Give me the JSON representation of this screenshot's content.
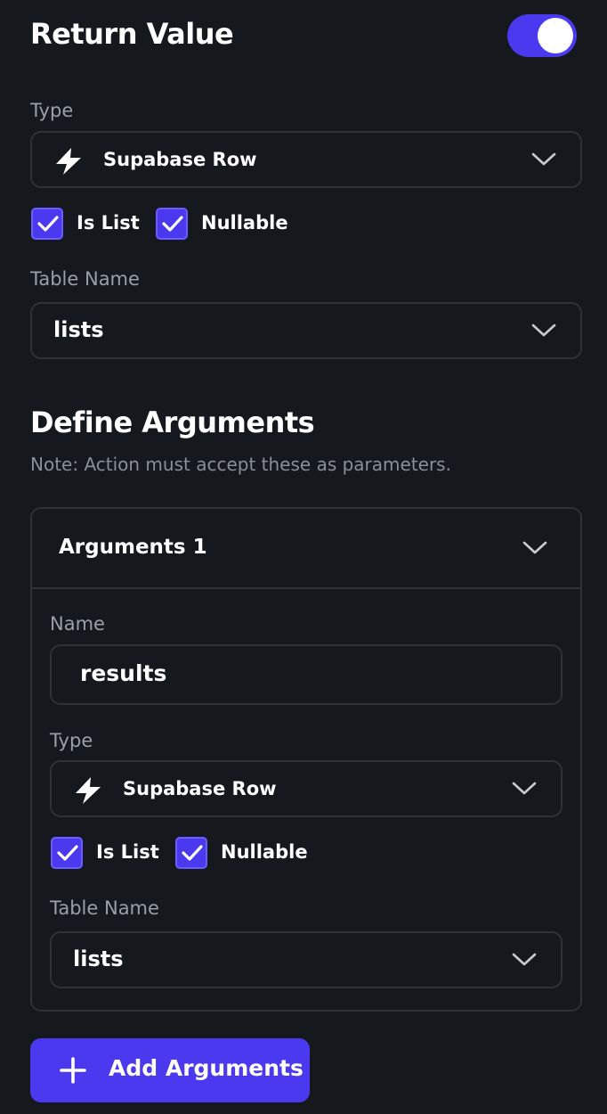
{
  "return_value": {
    "title": "Return Value",
    "toggle_on": true,
    "type_label": "Type",
    "type_value": "Supabase Row",
    "is_list_label": "Is List",
    "is_list_checked": true,
    "nullable_label": "Nullable",
    "nullable_checked": true,
    "table_name_label": "Table Name",
    "table_name_value": "lists"
  },
  "define_arguments": {
    "title": "Define Arguments",
    "note": "Note: Action must accept these as parameters."
  },
  "argument": {
    "header": "Arguments 1",
    "name_label": "Name",
    "name_value": "results",
    "type_label": "Type",
    "type_value": "Supabase Row",
    "is_list_label": "Is List",
    "is_list_checked": true,
    "nullable_label": "Nullable",
    "nullable_checked": true,
    "table_name_label": "Table Name",
    "table_name_value": "lists"
  },
  "add_button": {
    "label": "Add Arguments"
  },
  "colors": {
    "background": "#15181c",
    "accent": "#4b39ef",
    "border": "#2e3237",
    "muted_text": "#9aa0a6"
  },
  "icons": [
    "bolt-icon",
    "chevron-down-icon",
    "checkmark-icon",
    "plus-icon"
  ]
}
